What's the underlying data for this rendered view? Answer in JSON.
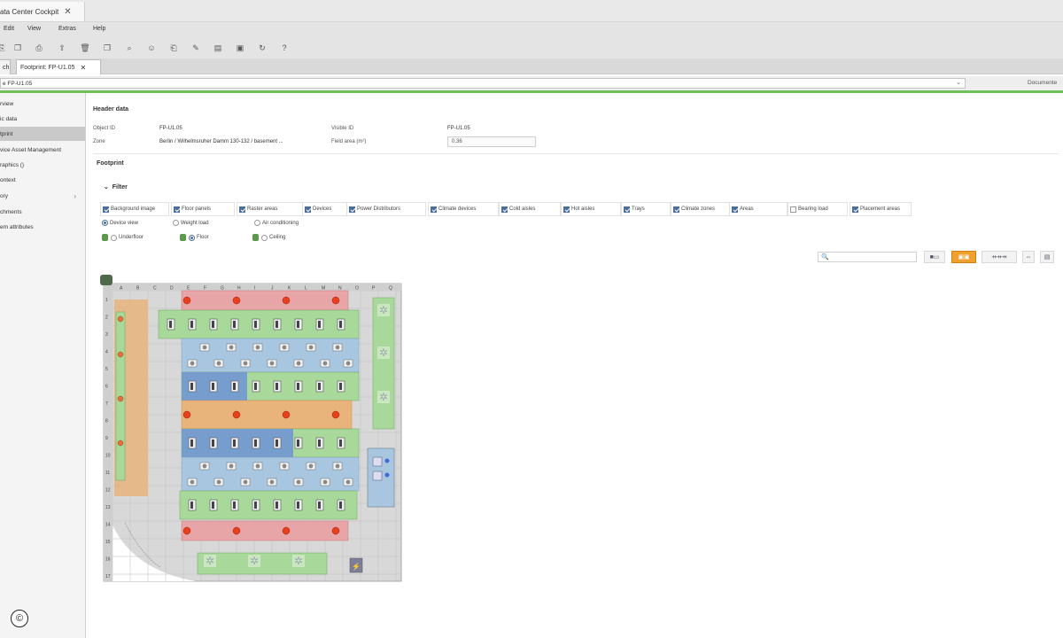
{
  "window": {
    "tab_title": "ata Center Cockpit",
    "close": "✕"
  },
  "menu": [
    "Edit",
    "View",
    "Extras",
    "Help"
  ],
  "menu_prefix": "",
  "toolbar_icons": [
    "new-icon",
    "copy-icon",
    "save-icon",
    "delete-icon",
    "duplicate-icon",
    "search-icon",
    "chat-icon",
    "attach-icon",
    "edit-icon",
    "print-icon",
    "refresh-icon",
    "sync-icon",
    "help-icon"
  ],
  "doc_tabs": [
    {
      "label": "ch",
      "active": false
    },
    {
      "label": "Footprint: FP-U1.05",
      "active": true,
      "close": "✕"
    }
  ],
  "address": {
    "value": "e FP-U1.05",
    "doc_label": "Documente"
  },
  "sidebar": {
    "items": [
      {
        "label": "rview",
        "active": false
      },
      {
        "label": "ic data",
        "active": false
      },
      {
        "label": "tprint",
        "active": true
      },
      {
        "label": "vice Asset Management",
        "active": false
      },
      {
        "label": "raphics ()",
        "active": false
      },
      {
        "label": "ontext",
        "active": false
      },
      {
        "label": "ory",
        "active": false,
        "arrow": "›"
      },
      {
        "label": "chments",
        "active": false
      },
      {
        "label": "em attributes",
        "active": false
      }
    ]
  },
  "header_data": {
    "title": "Header data",
    "object_id_label": "Object ID",
    "object_id_value": "FP-U1.05",
    "visible_id_label": "Visible ID",
    "visible_id_value": "FP-U1.05",
    "zone_label": "Zone",
    "zone_value": "Berlin / Wilhelmsruher Damm 130-132 / basement ...",
    "field_area_label": "Field area (m²)",
    "field_area_value": "0.36"
  },
  "footprint": {
    "title": "Footprint",
    "filter_label": "Filter",
    "filters": [
      {
        "label": "Background image",
        "checked": true
      },
      {
        "label": "Floor panels",
        "checked": true
      },
      {
        "label": "Raster areas",
        "checked": true
      },
      {
        "label": "Devices",
        "checked": true
      },
      {
        "label": "Power Distributors",
        "checked": true
      },
      {
        "label": "Climate devices",
        "checked": true
      },
      {
        "label": "Cold aisles",
        "checked": true
      },
      {
        "label": "Hot aisles",
        "checked": true
      },
      {
        "label": "Trays",
        "checked": true
      },
      {
        "label": "Climate zones",
        "checked": true
      },
      {
        "label": "Areas",
        "checked": true
      },
      {
        "label": "Bearing load",
        "checked": false
      },
      {
        "label": "Placement areas",
        "checked": true
      }
    ],
    "views": [
      {
        "label": "Device view",
        "selected": true
      },
      {
        "label": "Weight load",
        "selected": false
      },
      {
        "label": "Air conditioning",
        "selected": false
      }
    ],
    "layers": [
      {
        "label": "Underfloor",
        "selected": false
      },
      {
        "label": "Floor",
        "selected": true
      },
      {
        "label": "Ceiling",
        "selected": false
      }
    ],
    "search_placeholder": "🔍",
    "column_labels": [
      "A",
      "B",
      "C",
      "D",
      "E",
      "F",
      "G",
      "H",
      "I",
      "J",
      "K",
      "L",
      "M",
      "N",
      "O",
      "P",
      "Q"
    ],
    "row_labels": [
      "1",
      "2",
      "3",
      "4",
      "5",
      "6",
      "7",
      "8",
      "9",
      "10",
      "11",
      "12",
      "13",
      "14",
      "15",
      "16",
      "17"
    ]
  },
  "colors": {
    "accent_green": "#6fbf5a",
    "hot_aisle": "#e8a5a8",
    "cold_aisle": "#a9c6e0",
    "climate_zone": "#e8b47c",
    "rack_row": "#a8d89a"
  }
}
